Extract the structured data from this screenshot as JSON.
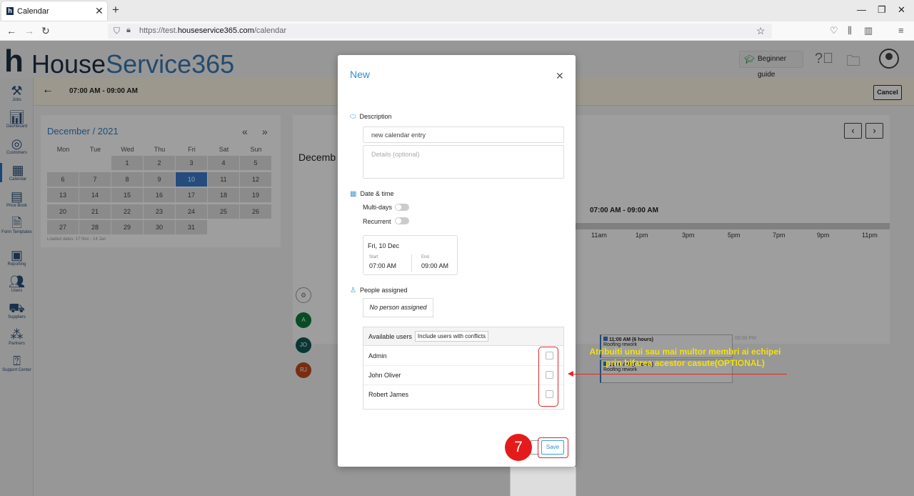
{
  "browser": {
    "tab_title": "Calendar",
    "url_prefix": "https://test.",
    "url_domain": "houseservice365.com",
    "url_path": "/calendar"
  },
  "app": {
    "logo_h": "h",
    "logo_part1": "House",
    "logo_part2": "Service365",
    "beginner_guide": "Beginner guide"
  },
  "sidebar": {
    "items": [
      {
        "label": "Jobs",
        "icon": "tools-icon"
      },
      {
        "label": "Dashboard",
        "icon": "chart-icon"
      },
      {
        "label": "Customers",
        "icon": "target-icon"
      },
      {
        "label": "Calendar",
        "icon": "calendar-icon"
      },
      {
        "label": "Price Book",
        "icon": "price-book-icon"
      },
      {
        "label": "Form Templates",
        "icon": "form-icon"
      },
      {
        "label": "Reporting",
        "icon": "report-icon"
      },
      {
        "label": "Users",
        "icon": "users-icon"
      },
      {
        "label": "Suppliers",
        "icon": "truck-icon"
      },
      {
        "label": "Partners",
        "icon": "partners-icon"
      },
      {
        "label": "Support Center",
        "icon": "help-icon"
      }
    ]
  },
  "ribbon": {
    "time": "07:00 AM - 09:00 AM",
    "cancel": "Cancel"
  },
  "minical": {
    "title": "December / 2021",
    "weekdays": [
      "Mon",
      "Tue",
      "Wed",
      "Thu",
      "Fri",
      "Sat",
      "Sun"
    ],
    "selected_day": "10",
    "loaded": "Loaded dates: 17 Nov - 14 Jan"
  },
  "schedule": {
    "heading": "Decemb",
    "time": "07:00 AM - 09:00 AM",
    "hours": [
      "11am",
      "1pm",
      "3pm",
      "5pm",
      "7pm",
      "9pm",
      "11pm"
    ],
    "people": [
      "A",
      "JO",
      "RJ"
    ],
    "events": [
      {
        "time": "11:00 AM (6 hours)",
        "title": "Roofing rework",
        "ghost": "09:00 PM"
      },
      {
        "time": "11:00 AM (6 hours)",
        "title": "Roofing rework",
        "ghost": "09:00 PM"
      }
    ]
  },
  "modal": {
    "title": "New",
    "description_label": "Description",
    "description_value": "new calendar entry",
    "details_placeholder": "Details (optional)",
    "datetime_label": "Date & time",
    "multidays_label": "Multi-days",
    "recurrent_label": "Recurrent",
    "date": "Fri, 10 Dec",
    "start_label": "Start",
    "start_value": "07:00 AM",
    "end_label": "End",
    "end_value": "09:00 AM",
    "people_label": "People assigned",
    "no_person": "No person assigned",
    "available_users": "Available users",
    "include_conflicts": "Include users with conflicts",
    "users": [
      "Admin",
      "John Oliver",
      "Robert James"
    ],
    "save": "Save"
  },
  "annotation": {
    "line1": "Atribuiti unui sau mai multor membri ai  echipei",
    "line2": "prin bifarea acestor casute(OPTIONAL)",
    "step": "7",
    "color": "#e0272b",
    "text_color": "#f2e10c"
  }
}
